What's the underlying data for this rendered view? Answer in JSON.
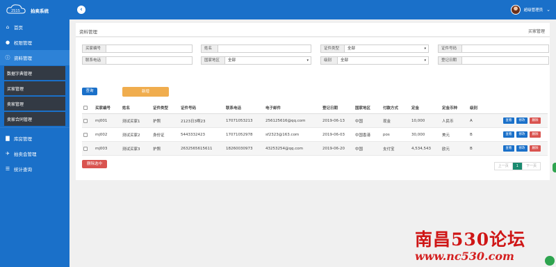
{
  "app": {
    "logo_text": "拍卖系统",
    "logo_mark": "2S1S"
  },
  "header": {
    "user_name": "超级管理员",
    "caret": "⌄"
  },
  "sidebar": {
    "items": [
      {
        "label": "首页",
        "icon": "home-icon",
        "glyph": "⌂"
      },
      {
        "label": "权限管理",
        "icon": "user-icon",
        "glyph": "👤"
      },
      {
        "label": "资料管理",
        "icon": "info-icon",
        "glyph": "ⓘ"
      },
      {
        "label": "库房管理",
        "icon": "warehouse-icon",
        "glyph": "▇"
      },
      {
        "label": "拍卖会管理",
        "icon": "gavel-icon",
        "glyph": "✈"
      },
      {
        "label": "统计查询",
        "icon": "list-icon",
        "glyph": "☰"
      }
    ],
    "sub_items": [
      "数据字典管理",
      "买家管理",
      "卖家管理",
      "卖家合同管理"
    ]
  },
  "breadcrumb": {
    "title": "资料管理",
    "current": "买家管理"
  },
  "filters": {
    "buyer_no": {
      "label": "买家编号",
      "value": ""
    },
    "name": {
      "label": "姓名",
      "value": ""
    },
    "id_type": {
      "label": "证件类型",
      "value": "全部"
    },
    "id_no": {
      "label": "证件号码",
      "value": ""
    },
    "phone": {
      "label": "联系电话",
      "value": ""
    },
    "region": {
      "label": "国家地区",
      "value": "全部"
    },
    "level": {
      "label": "级别",
      "value": "全部"
    },
    "reg_date": {
      "label": "登记日期",
      "value": ""
    }
  },
  "buttons": {
    "query": "查询",
    "add": "新增",
    "delete_selected": "删除选中"
  },
  "table": {
    "headers": [
      "买家编号",
      "姓名",
      "证件类型",
      "证件号码",
      "联系电话",
      "电子邮件",
      "登记日期",
      "国家地区",
      "付款方式",
      "定金",
      "定金币种",
      "级别"
    ],
    "rows": [
      {
        "no": "mj001",
        "name": "测试买家1",
        "id_type": "护照",
        "id_no": "2123日3啊23",
        "phone": "17071053213",
        "email": "256125616@qq.com",
        "date": "2019-06-13",
        "region": "中国",
        "pay": "现金",
        "deposit": "10,000",
        "currency": "人民币",
        "level": "A"
      },
      {
        "no": "mj002",
        "name": "测试买家2",
        "id_type": "身份证",
        "id_no": "5443332423",
        "phone": "17071052978",
        "email": "sf2323@163.com",
        "date": "2019-06-03",
        "region": "中国香港",
        "pay": "pos",
        "deposit": "30,000",
        "currency": "美元",
        "level": "B"
      },
      {
        "no": "mj003",
        "name": "测试买家3",
        "id_type": "护照",
        "id_no": "2632565615611",
        "phone": "18260030973",
        "email": "43253254@qq.com",
        "date": "2019-06-20",
        "region": "中国",
        "pay": "支付宝",
        "deposit": "4,534,543",
        "currency": "欧元",
        "level": "B"
      }
    ],
    "actions": {
      "view": "查看",
      "edit": "修改",
      "delete": "删除"
    }
  },
  "pagination": {
    "prev": "上一页",
    "current": "1",
    "next": "下一页"
  },
  "watermark": {
    "cn": "南昌530论坛",
    "url": "www.nc530.com"
  },
  "colors": {
    "primary": "#1a70c9",
    "sub_item_bg": "#333a44",
    "danger": "#d9534f",
    "warning": "#f0ad4e",
    "page_active": "#1a8a6f"
  }
}
